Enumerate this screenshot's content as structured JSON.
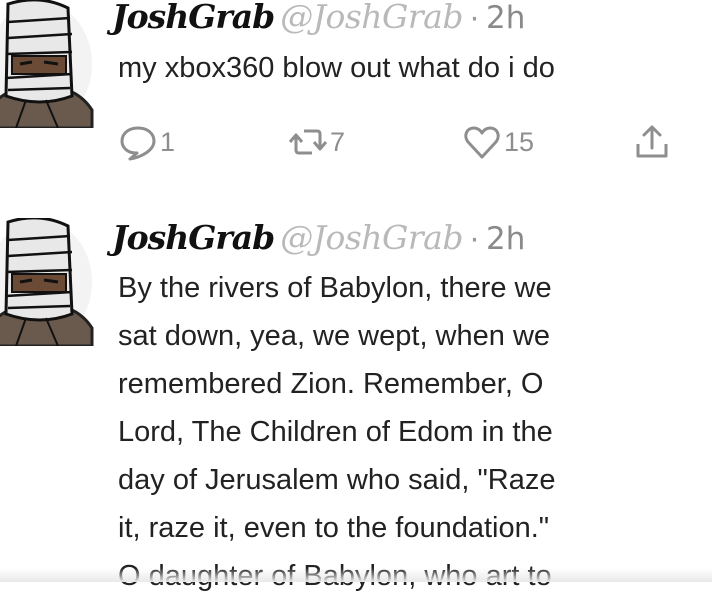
{
  "tweets": [
    {
      "author_name": "JoshGrab",
      "author_handle": "@JoshGrab",
      "separator": "·",
      "time": "2h",
      "text_lines": [
        "my xbox360 blow out what do i do"
      ],
      "actions": {
        "reply_count": "1",
        "retweet_count": "7",
        "like_count": "15"
      }
    },
    {
      "author_name": "JoshGrab",
      "author_handle": "@JoshGrab",
      "separator": "·",
      "time": "2h",
      "text_lines": [
        "By the rivers of Babylon, there we",
        "sat down, yea, we wept, when we",
        "remembered Zion. Remember, O",
        "Lord, The Children of Edom in the",
        "day of Jerusalem who said, \"Raze",
        "it, raze it, even to the foundation.\"",
        "O daughter of Babylon, who art to"
      ]
    }
  ],
  "icons": {
    "reply": "speech-bubble-icon",
    "retweet": "retweet-arrows-icon",
    "like": "heart-icon",
    "share": "share-upload-icon"
  },
  "colors": {
    "handle": "#b9b9b9",
    "action_gray": "#8e8e8e",
    "text": "#222222"
  }
}
